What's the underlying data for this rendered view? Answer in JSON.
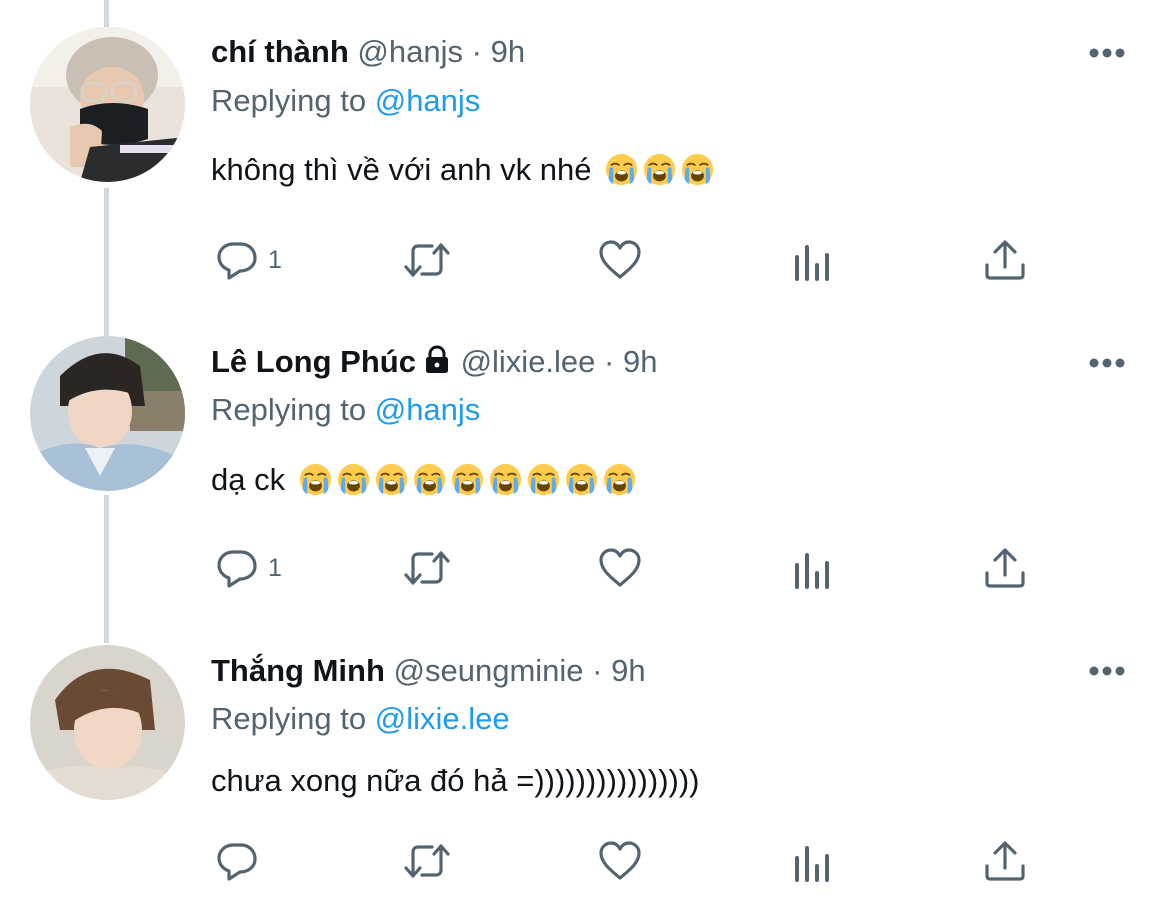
{
  "tweets": [
    {
      "name": "chí thành",
      "handle": "@hanjs",
      "time": "9h",
      "replying_prefix": "Replying to",
      "replying_to": "@hanjs",
      "text": "không thì về với anh vk nhé",
      "emoji_count": 3,
      "locked": false,
      "reply_count": "1"
    },
    {
      "name": "Lê Long Phúc",
      "handle": "@lixie.lee",
      "time": "9h",
      "replying_prefix": "Replying to",
      "replying_to": "@hanjs",
      "text": "dạ ck",
      "emoji_count": 9,
      "locked": true,
      "reply_count": "1"
    },
    {
      "name": "Thắng Minh",
      "handle": "@seungminie",
      "time": "9h",
      "replying_prefix": "Replying to",
      "replying_to": "@lixie.lee",
      "text": "chưa xong nữa đó hả =))))))))))))))))",
      "emoji_count": 0,
      "locked": false,
      "reply_count": ""
    }
  ],
  "separator": "·",
  "icons": {
    "reply": "speech-bubble-icon",
    "retweet": "retweet-arrows-icon",
    "like": "heart-icon",
    "analytics": "bar-chart-icon",
    "share": "share-upload-icon",
    "more": "more-dots-icon",
    "emoji": "loudly-crying-face-emoji",
    "lock": "lock-icon"
  },
  "colors": {
    "text": "#0f1419",
    "secondary": "#536471",
    "link": "#1d9bf0",
    "thread_line": "#cfd9de"
  }
}
